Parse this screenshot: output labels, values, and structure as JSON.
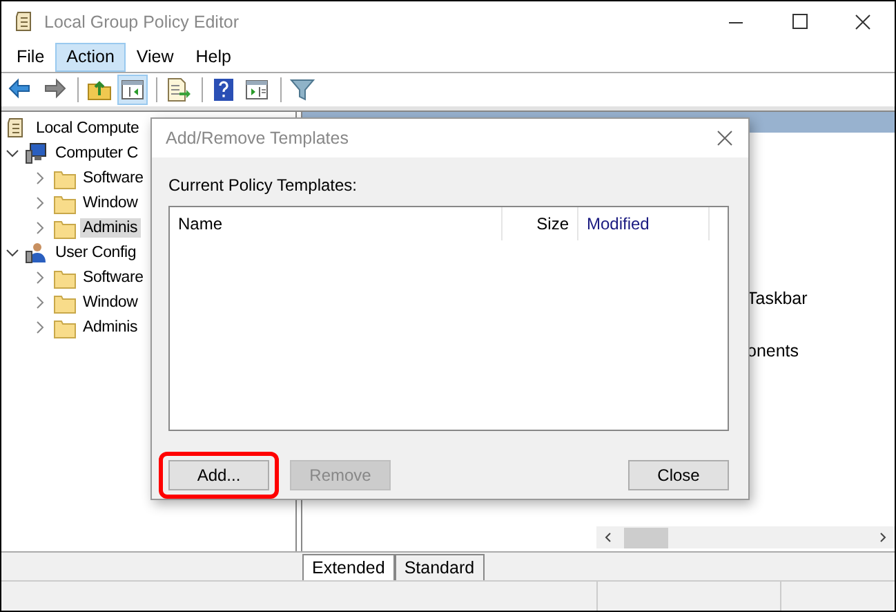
{
  "window": {
    "title": "Local Group Policy Editor"
  },
  "menu": [
    {
      "label": "File",
      "selected": false
    },
    {
      "label": "Action",
      "selected": true
    },
    {
      "label": "View",
      "selected": false
    },
    {
      "label": "Help",
      "selected": false
    }
  ],
  "toolbar": [
    {
      "kind": "back",
      "pressed": false
    },
    {
      "kind": "forward",
      "pressed": false
    },
    {
      "kind": "sep"
    },
    {
      "kind": "up",
      "pressed": false
    },
    {
      "kind": "pane",
      "pressed": true
    },
    {
      "kind": "sep"
    },
    {
      "kind": "export",
      "pressed": false
    },
    {
      "kind": "sep"
    },
    {
      "kind": "help",
      "pressed": false
    },
    {
      "kind": "props",
      "pressed": false
    },
    {
      "kind": "sep"
    },
    {
      "kind": "filter",
      "pressed": false
    }
  ],
  "tree": [
    {
      "label": "Local Compute",
      "kind": "root",
      "children": [
        {
          "label": "Computer C",
          "kind": "computer",
          "expanded": true,
          "children": [
            {
              "label": "Software",
              "kind": "folder",
              "selected": false
            },
            {
              "label": "Window",
              "kind": "folder",
              "selected": false
            },
            {
              "label": "Adminis",
              "kind": "folder",
              "selected": true
            }
          ]
        },
        {
          "label": "User Config",
          "kind": "user",
          "expanded": true,
          "children": [
            {
              "label": "Software",
              "kind": "folder",
              "selected": false
            },
            {
              "label": "Window",
              "kind": "folder",
              "selected": false
            },
            {
              "label": "Adminis",
              "kind": "folder",
              "selected": false
            }
          ]
        }
      ]
    }
  ],
  "details": {
    "items": [
      "Taskbar",
      "onents"
    ]
  },
  "view_tabs": [
    {
      "label": "Extended",
      "selected": true
    },
    {
      "label": "Standard",
      "selected": false
    }
  ],
  "dialog": {
    "title": "Add/Remove Templates",
    "label": "Current Policy Templates:",
    "columns": [
      "Name",
      "Size",
      "Modified"
    ],
    "buttons": [
      {
        "label": "Add...",
        "disabled": false,
        "highlighted": true
      },
      {
        "label": "Remove",
        "disabled": true,
        "highlighted": false
      },
      {
        "label": "Close",
        "disabled": false,
        "highlighted": false
      }
    ]
  }
}
